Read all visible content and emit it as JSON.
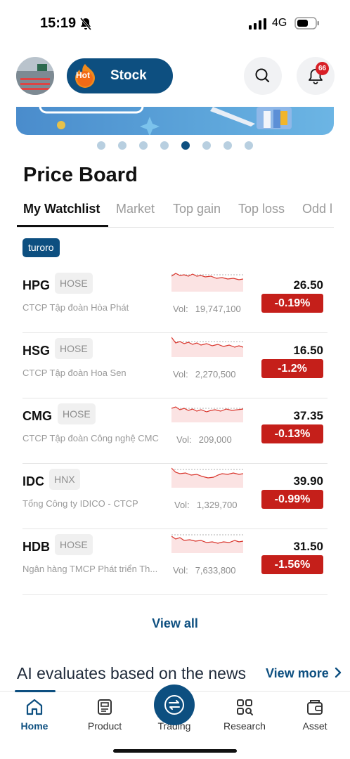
{
  "status_bar": {
    "time": "15:19",
    "network": "4G",
    "icons": [
      "bell-off-icon",
      "signal-icon",
      "battery-icon"
    ]
  },
  "header": {
    "hot_badge": "Hot",
    "hot_label": "Stock",
    "notification_count": "66",
    "icons": [
      "search-icon",
      "bell-icon"
    ]
  },
  "banner": {
    "page_count": 8,
    "active_page": 5
  },
  "price_board": {
    "title": "Price Board",
    "tabs": [
      {
        "label": "My Watchlist",
        "active": true
      },
      {
        "label": "Market",
        "active": false
      },
      {
        "label": "Top gain",
        "active": false
      },
      {
        "label": "Top loss",
        "active": false
      },
      {
        "label": "Odd l",
        "active": false
      }
    ],
    "watchlist_chip": "turoro",
    "rows": [
      {
        "symbol": "HPG",
        "exchange": "HOSE",
        "company": "CTCP Tập đoàn Hòa Phát",
        "vol_label": "Vol:",
        "volume": "19,747,100",
        "price": "26.50",
        "change": "-0.19%"
      },
      {
        "symbol": "HSG",
        "exchange": "HOSE",
        "company": "CTCP Tập đoàn Hoa Sen",
        "vol_label": "Vol:",
        "volume": "2,270,500",
        "price": "16.50",
        "change": "-1.2%"
      },
      {
        "symbol": "CMG",
        "exchange": "HOSE",
        "company": "CTCP Tập đoàn Công nghệ CMC",
        "vol_label": "Vol:",
        "volume": "209,000",
        "price": "37.35",
        "change": "-0.13%"
      },
      {
        "symbol": "IDC",
        "exchange": "HNX",
        "company": "Tổng Công ty IDICO - CTCP",
        "vol_label": "Vol:",
        "volume": "1,329,700",
        "price": "39.90",
        "change": "-0.99%"
      },
      {
        "symbol": "HDB",
        "exchange": "HOSE",
        "company": "Ngân hàng TMCP Phát triển Th...",
        "vol_label": "Vol:",
        "volume": "7,633,800",
        "price": "31.50",
        "change": "-1.56%"
      }
    ],
    "view_all": "View all"
  },
  "ai_section": {
    "title": "AI evaluates based on the news",
    "view_more": "View more",
    "view_more_icon": "chevron-right-icon"
  },
  "bottom_nav": {
    "items": [
      {
        "label": "Home",
        "icon": "home-icon",
        "active": true
      },
      {
        "label": "Product",
        "icon": "document-icon",
        "active": false
      },
      {
        "label": "Trading",
        "icon": "exchange-icon",
        "active": false
      },
      {
        "label": "Research",
        "icon": "grid-search-icon",
        "active": false
      },
      {
        "label": "Asset",
        "icon": "wallet-icon",
        "active": false
      }
    ]
  },
  "colors": {
    "primary": "#0d4f80",
    "negative": "#c51f1a",
    "badge_red": "#d81f26"
  }
}
